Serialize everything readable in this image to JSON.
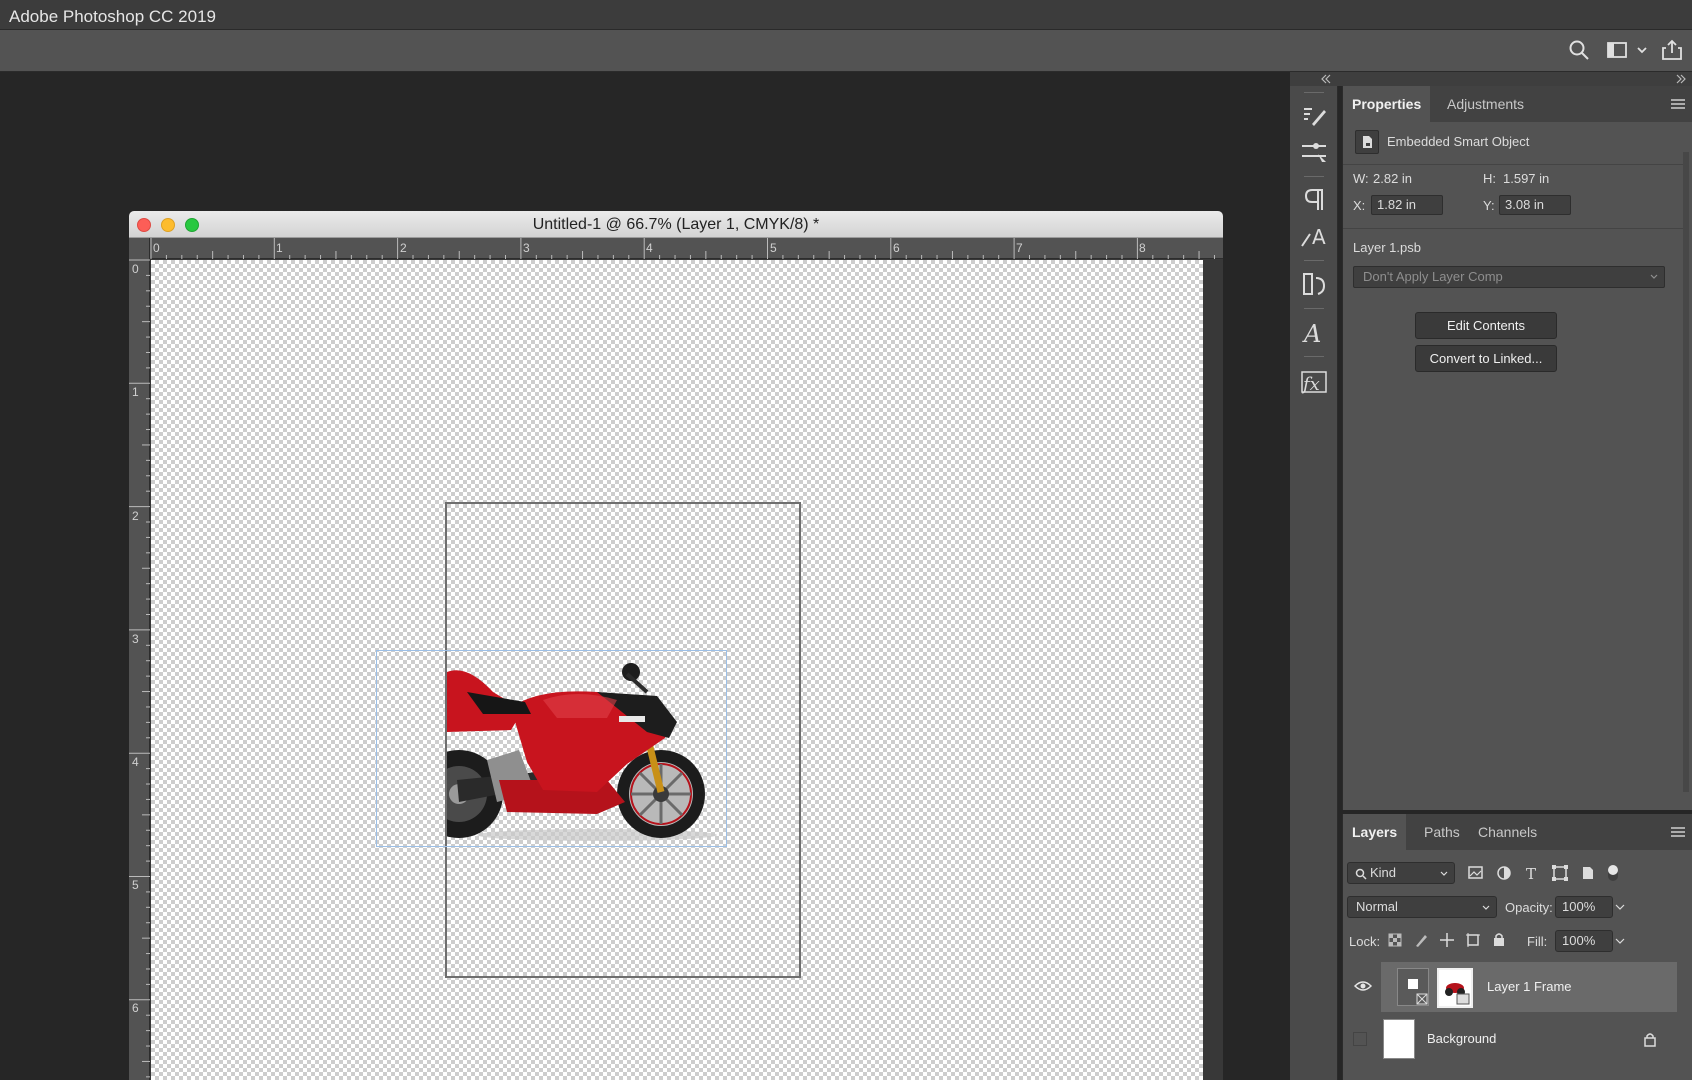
{
  "app": {
    "title": "Adobe Photoshop CC 2019"
  },
  "document": {
    "title": "Untitled-1 @ 66.7% (Layer 1, CMYK/8) *"
  },
  "rulers": {
    "horizontal": [
      "0",
      "1",
      "2",
      "3",
      "4",
      "5",
      "6",
      "7",
      "8"
    ],
    "vertical": [
      "0",
      "1",
      "2",
      "3",
      "4",
      "5",
      "6"
    ]
  },
  "properties": {
    "tabs": [
      "Properties",
      "Adjustments"
    ],
    "object_type": "Embedded Smart Object",
    "w_label": "W:",
    "w_value": "2.82 in",
    "h_label": "H:",
    "h_value": "1.597 in",
    "x_label": "X:",
    "x_value": "1.82 in",
    "y_label": "Y:",
    "y_value": "3.08 in",
    "file_name": "Layer 1.psb",
    "layer_comp": "Don't Apply Layer Comp",
    "edit_contents": "Edit Contents",
    "convert_linked": "Convert to Linked..."
  },
  "layers": {
    "tabs": [
      "Layers",
      "Paths",
      "Channels"
    ],
    "filter_kind": "Kind",
    "blend_mode": "Normal",
    "opacity_label": "Opacity:",
    "opacity_value": "100%",
    "lock_label": "Lock:",
    "fill_label": "Fill:",
    "fill_value": "100%",
    "items": [
      {
        "name": "Layer 1 Frame",
        "visible": true,
        "selected": true
      },
      {
        "name": "Background",
        "visible": false,
        "locked": true
      }
    ]
  },
  "colors": {
    "accent_selection": "#7ba7d9",
    "motorcycle_red": "#b5121b"
  }
}
